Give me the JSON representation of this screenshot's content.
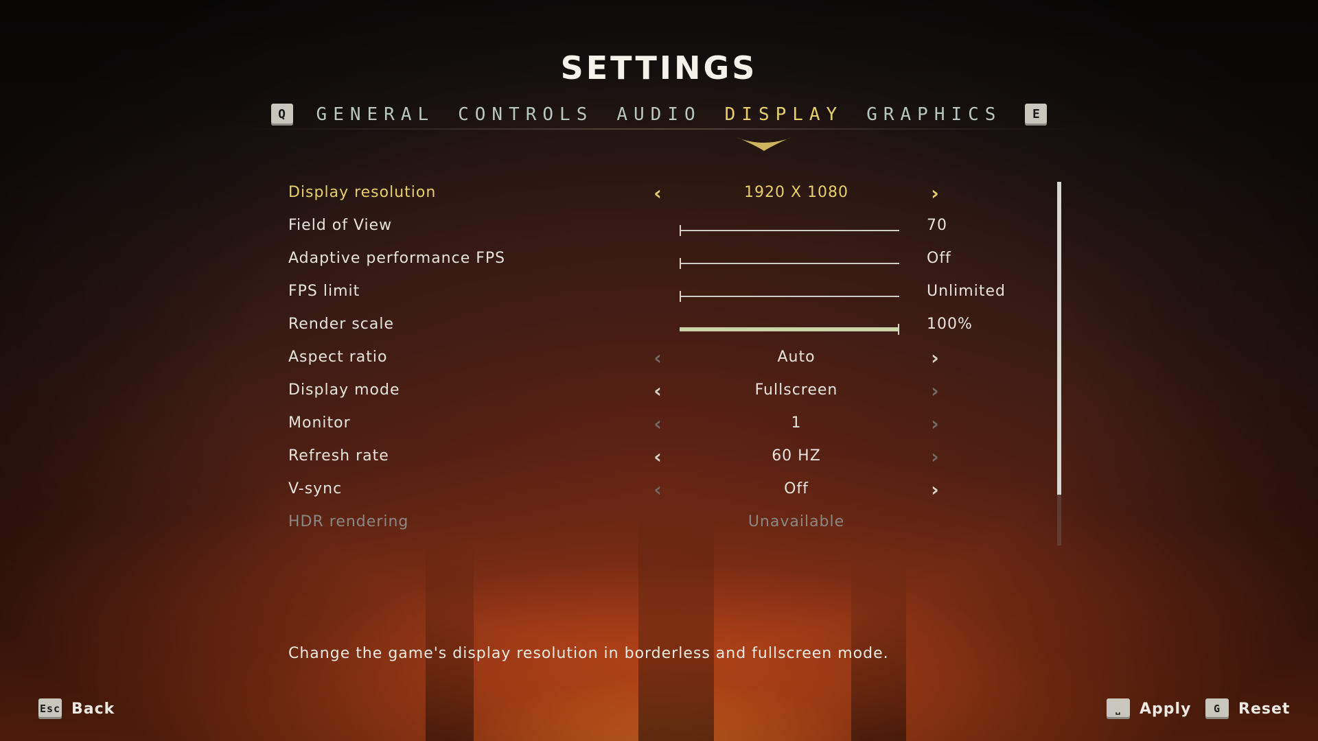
{
  "title": "SETTINGS",
  "tabs": {
    "prev_key": "Q",
    "next_key": "E",
    "items": [
      "GENERAL",
      "CONTROLS",
      "AUDIO",
      "DISPLAY",
      "GRAPHICS"
    ],
    "active": "DISPLAY"
  },
  "settings": [
    {
      "label": "Display resolution",
      "type": "selector",
      "value": "1920 X 1080"
    },
    {
      "label": "Field of View",
      "type": "slider",
      "value": "70",
      "level": 0.0
    },
    {
      "label": "Adaptive performance FPS",
      "type": "slider",
      "value": "Off",
      "level": 0.0
    },
    {
      "label": "FPS limit",
      "type": "slider",
      "value": "Unlimited",
      "level": 0.0
    },
    {
      "label": "Render scale",
      "type": "slider",
      "value": "100%",
      "level": 1.0
    },
    {
      "label": "Aspect ratio",
      "type": "selector",
      "value": "Auto"
    },
    {
      "label": "Display mode",
      "type": "selector",
      "value": "Fullscreen"
    },
    {
      "label": "Monitor",
      "type": "selector",
      "value": "1"
    },
    {
      "label": "Refresh rate",
      "type": "selector",
      "value": "60 HZ"
    },
    {
      "label": "V-sync",
      "type": "selector",
      "value": "Off"
    },
    {
      "label": "HDR rendering",
      "type": "static",
      "value": "Unavailable"
    }
  ],
  "description": "Change the game's display resolution in borderless and fullscreen mode.",
  "footer": {
    "back_key": "Esc",
    "back_label": "Back",
    "apply_key": "⎵",
    "apply_label": "Apply",
    "reset_key": "G",
    "reset_label": "Reset"
  },
  "scroll": {
    "visible_fraction": 0.86
  },
  "colors": {
    "accent": "#e8cf6a",
    "text": "#e6e4dc",
    "disabled": "#8b8884"
  }
}
